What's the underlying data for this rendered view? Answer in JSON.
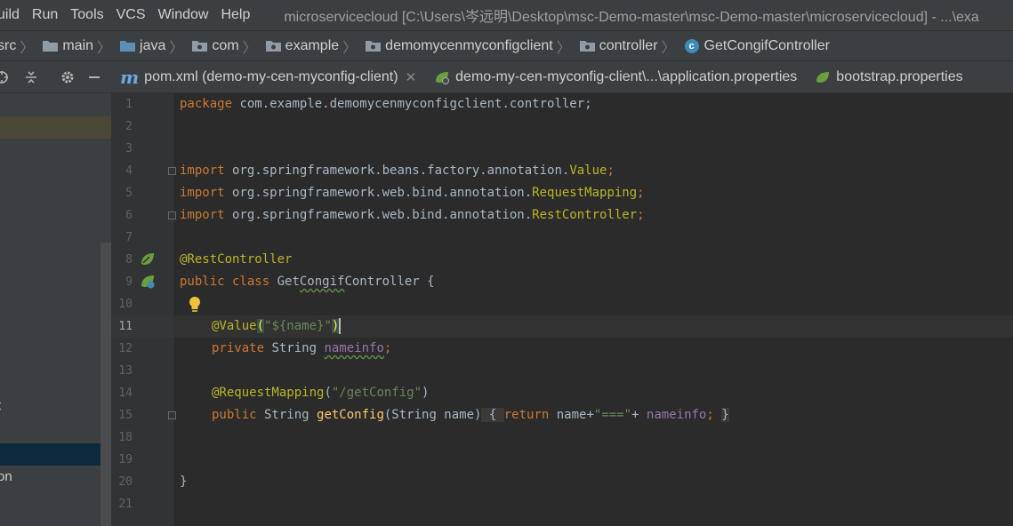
{
  "menu": [
    "uild",
    "Run",
    "Tools",
    "VCS",
    "Window",
    "Help"
  ],
  "window_title": "microservicecloud [C:\\Users\\岑远明\\Desktop\\msc-Demo-master\\msc-Demo-master\\microservicecloud] - ...\\exa",
  "breadcrumb": [
    "src",
    "main",
    "java",
    "com",
    "example",
    "demomycenmyconfigclient",
    "controller",
    "GetCongifController"
  ],
  "tabs": [
    {
      "label": "pom.xml (demo-my-cen-myconfig-client)",
      "icon": "maven-icon"
    },
    {
      "label": "demo-my-cen-myconfig-client\\...\\application.properties",
      "icon": "spring-leaf-icon"
    },
    {
      "label": "bootstrap.properties",
      "icon": "spring-leaf-icon"
    }
  ],
  "left_panel": {
    "item_t": "t",
    "item_on": "on"
  },
  "line_numbers": [
    "1",
    "2",
    "3",
    "4",
    "5",
    "6",
    "7",
    "8",
    "9",
    "10",
    "11",
    "12",
    "13",
    "14",
    "15",
    "18",
    "19",
    "20",
    "21"
  ],
  "code": {
    "l1_kw": "package",
    "l1_rest": " com.example.demomycenmyconfigclient.controller;",
    "l4_kw": "import",
    "l4_path": " org.springframework.beans.factory.annotation.",
    "l4_cls": "Value",
    "l4_end": ";",
    "l5_kw": "import",
    "l5_path": " org.springframework.web.bind.annotation.",
    "l5_cls": "RequestMapping",
    "l5_end": ";",
    "l6_kw": "import",
    "l6_path": " org.springframework.web.bind.annotation.",
    "l6_cls": "RestController",
    "l6_end": ";",
    "l8_ann": "@RestController",
    "l9_kw1": "public",
    "l9_kw2": " class",
    "l9_pre": " Get",
    "l9_wavy": "Congif",
    "l9_post": "Controller {",
    "l11_ann": "@Value",
    "l11_p1": "(",
    "l11_str": "\"${name}\"",
    "l11_p2": ")",
    "l12_kw": "private",
    "l12_type": " String ",
    "l12_fld": "nameinfo",
    "l12_end": ";",
    "l14_ann": "@RequestMapping",
    "l14_p1": "(",
    "l14_str": "\"/getConfig\"",
    "l14_p2": ")",
    "l15_kw": "public",
    "l15_type": " String ",
    "l15_mth": "getConfig",
    "l15_sig": "(String name)",
    "l15_b1": " { ",
    "l15_ret": "return",
    "l15_mid": " name+",
    "l15_str": "\"===\"",
    "l15_plus": "+ ",
    "l15_fld": "nameinfo",
    "l15_end": "; ",
    "l15_b2": "}",
    "l20": "}"
  }
}
